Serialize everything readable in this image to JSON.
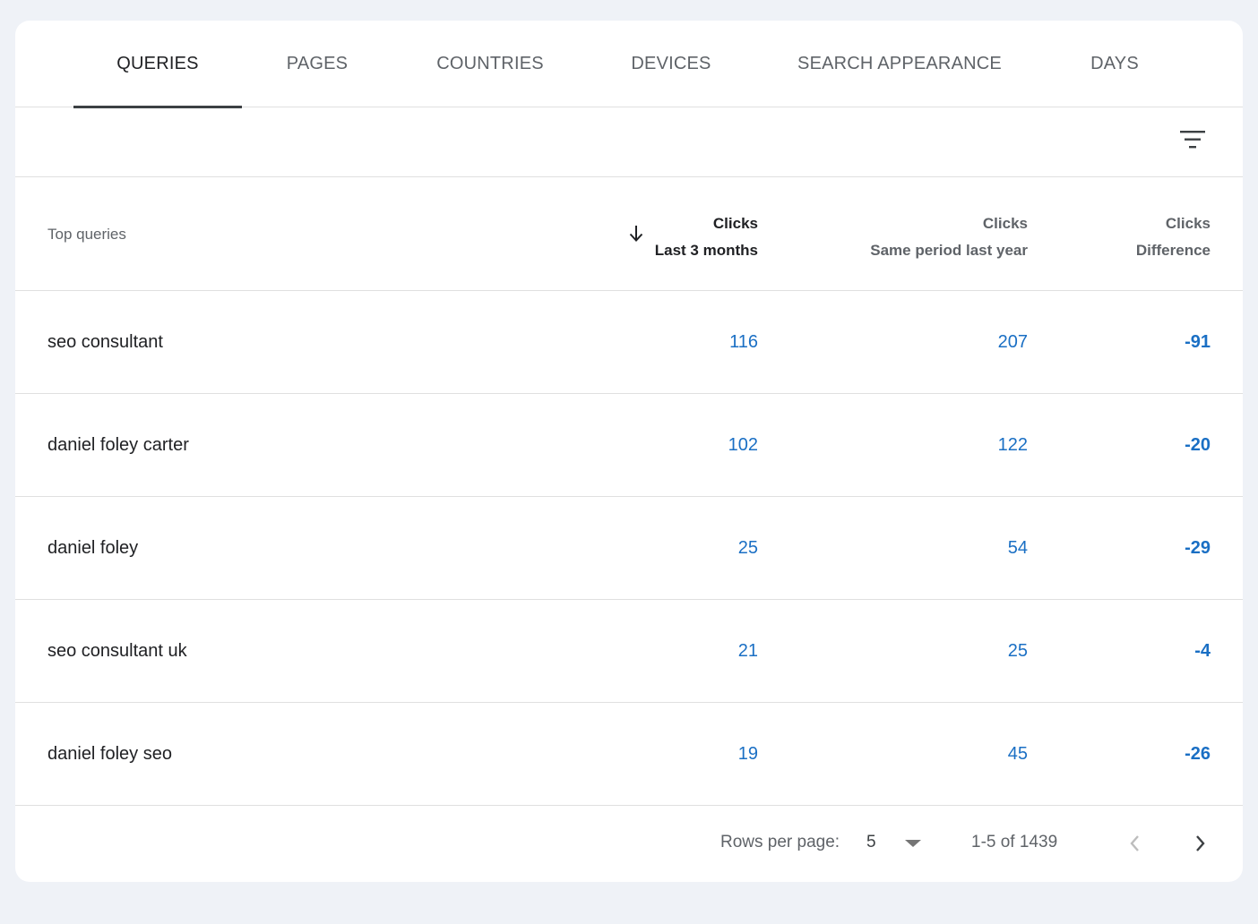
{
  "tabs": [
    {
      "label": "QUERIES",
      "active": true
    },
    {
      "label": "PAGES",
      "active": false
    },
    {
      "label": "COUNTRIES",
      "active": false
    },
    {
      "label": "DEVICES",
      "active": false
    },
    {
      "label": "SEARCH APPEARANCE",
      "active": false
    },
    {
      "label": "DAYS",
      "active": false
    }
  ],
  "toolbar": {
    "filter_icon": "filter-icon"
  },
  "table": {
    "header": {
      "label": "Top queries",
      "col1": {
        "title": "Clicks",
        "subtitle": "Last 3 months",
        "sorted": true,
        "sort_icon": "arrow-down-icon"
      },
      "col2": {
        "title": "Clicks",
        "subtitle": "Same period last year"
      },
      "col3": {
        "title": "Clicks",
        "subtitle": "Difference"
      }
    },
    "rows": [
      {
        "query": "seo consultant",
        "last3": "116",
        "lastyear": "207",
        "diff": "-91"
      },
      {
        "query": "daniel foley carter",
        "last3": "102",
        "lastyear": "122",
        "diff": "-20"
      },
      {
        "query": "daniel foley",
        "last3": "25",
        "lastyear": "54",
        "diff": "-29"
      },
      {
        "query": "seo consultant uk",
        "last3": "21",
        "lastyear": "25",
        "diff": "-4"
      },
      {
        "query": "daniel foley seo",
        "last3": "19",
        "lastyear": "45",
        "diff": "-26"
      }
    ]
  },
  "pagination": {
    "rows_per_page_label": "Rows per page:",
    "rows_per_page_value": "5",
    "range": "1-5 of 1439",
    "prev_icon": "chevron-left-icon",
    "next_icon": "chevron-right-icon"
  },
  "colors": {
    "accent": "#1a6fc4",
    "text": "#202124",
    "muted": "#5f6368",
    "background": "#eff2f7"
  }
}
